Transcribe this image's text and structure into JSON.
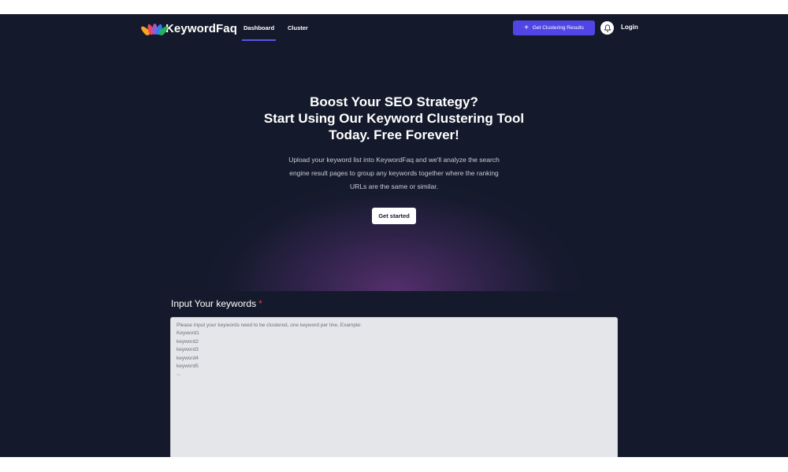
{
  "nav": {
    "logo_text": "KeywordFaq",
    "links": [
      {
        "label": "Dashboard",
        "active": true
      },
      {
        "label": "Cluster",
        "active": false
      }
    ],
    "cta_label": "Get Clustering Results",
    "login_label": "Login"
  },
  "hero": {
    "title_lines": [
      "Boost Your SEO Strategy?",
      "Start Using Our Keyword Clustering Tool",
      "Today. Free Forever!"
    ],
    "description_lines": [
      "Upload your keyword list into KeywordFaq and we'll analyze the search",
      "engine result pages to group any keywords together where the ranking",
      "URLs are the same or similar."
    ],
    "button_label": "Get started"
  },
  "keywords": {
    "label": "Input Your keywords",
    "required_mark": "*",
    "placeholder": "Please Input your keywords need to be clustered, one keyword per line, Example:\nKeyword1\nkeyword2\nkeyword3\nkeyword4\nkeyword5\n..."
  },
  "colors": {
    "background": "#141a2b",
    "accent": "#5046e5",
    "required": "#e53e3e"
  }
}
